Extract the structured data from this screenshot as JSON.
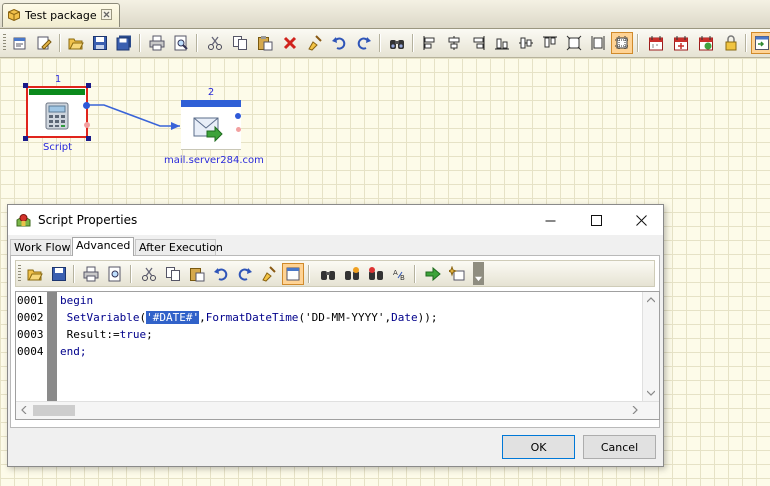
{
  "tab": {
    "title": "Test package",
    "icon": "package-icon",
    "close_icon": "close-icon"
  },
  "toolbar": {
    "buttons": [
      "properties-icon",
      "edit-icon",
      "open-folder-icon",
      "save-icon",
      "save-all-icon",
      "print-icon",
      "print-preview-icon",
      "cut-icon",
      "copy-icon",
      "paste-icon",
      "delete-icon",
      "clear-icon",
      "undo-icon",
      "redo-icon",
      "find-icon",
      "align-left-icon",
      "align-center-icon",
      "align-right-icon",
      "align-bottom-icon",
      "align-middle-icon",
      "align-top-icon",
      "same-size-icon",
      "same-height-icon",
      "grid-snap-icon",
      "schedule-icon",
      "schedule-add-icon",
      "schedule-run-icon",
      "lock-icon",
      "export-icon"
    ],
    "active_button": "grid-snap-icon"
  },
  "canvas": {
    "nodes": [
      {
        "number": "1",
        "label": "Script",
        "icon": "calculator-icon"
      },
      {
        "number": "2",
        "label": "mail.server284.com",
        "icon": "email-send-icon"
      }
    ]
  },
  "dialog": {
    "title": "Script Properties",
    "title_icon": "script-icon",
    "tabs": [
      "Work Flow",
      "Advanced",
      "After Execution"
    ],
    "selected_tab": "Advanced",
    "editor": {
      "line_numbers": [
        "0001",
        "0002",
        "0003",
        "0004"
      ],
      "lines": [
        "begin",
        " SetVariable('#DATE#',FormatDateTime('DD-MM-YYYY',Date));",
        " Result:=true;",
        "end;"
      ],
      "selected_text": "'#DATE#'"
    },
    "ok_label": "OK",
    "cancel_label": "Cancel",
    "window_buttons": [
      "minimize-icon",
      "maximize-icon",
      "close-icon"
    ]
  },
  "colors": {
    "canvas_bg": "#fdfbe9",
    "link": "#2a2adb",
    "selection": "#3162c9",
    "keyword": "#00008b"
  }
}
